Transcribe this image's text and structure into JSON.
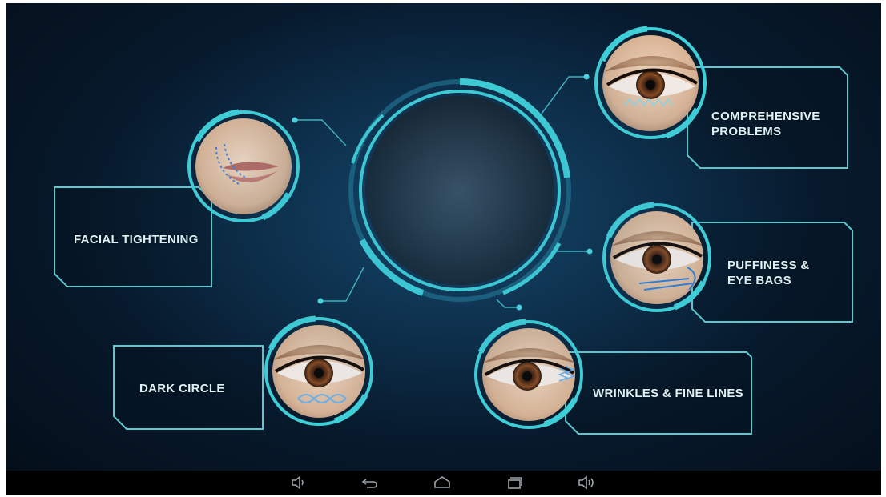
{
  "features": {
    "facial_tightening": {
      "label": "FACIAL TIGHTENING"
    },
    "comprehensive_problems": {
      "line1": "COMPREHENSIVE",
      "line2": "PROBLEMS"
    },
    "puffiness_eye_bags": {
      "line1": "PUFFINESS &",
      "line2": "EYE BAGS"
    },
    "dark_circle": {
      "label": "DARK CIRCLE"
    },
    "wrinkles_fine_lines": {
      "label": "WRINKLES & FINE LINES"
    }
  },
  "navbar": {
    "buttons": [
      "volume-down",
      "back",
      "home",
      "recent-apps",
      "volume-up"
    ]
  },
  "colors": {
    "accent": "#3fd0d8",
    "panel_border": "#5ec8cf",
    "background": "#071a2d"
  }
}
